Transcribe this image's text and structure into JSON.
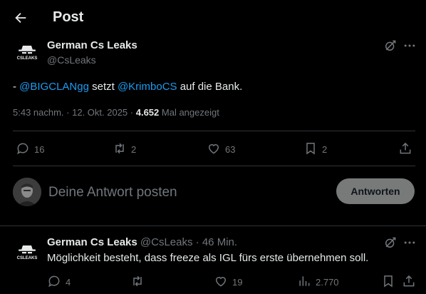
{
  "header": {
    "title": "Post"
  },
  "post": {
    "author_name": "German Cs Leaks",
    "author_handle": "@CsLeaks",
    "avatar_text": "CSLEAKS",
    "text_prefix": "- ",
    "mention_1": "@BIGCLANgg",
    "text_mid": " setzt ",
    "mention_2": "@KrimboCS",
    "text_suffix": " auf die Bank.",
    "time": "5:43 nachm.",
    "sep1": " · ",
    "date": "12. Okt. 2025",
    "sep2": " · ",
    "views_count": "4.652",
    "views_label": " Mal angezeigt",
    "replies": "16",
    "reposts": "2",
    "likes": "63",
    "bookmarks": "2"
  },
  "composer": {
    "placeholder": "Deine Antwort posten",
    "button_label": "Antworten"
  },
  "reply": {
    "author_name": "German Cs Leaks",
    "author_handle": "@CsLeaks",
    "separator": " · ",
    "time": "46 Min.",
    "avatar_text": "CSLEAKS",
    "text": "Möglichkeit besteht, dass freeze als IGL fürs erste übernehmen soll.",
    "replies": "4",
    "reposts": "",
    "likes": "19",
    "views": "2.770"
  },
  "colors": {
    "accent": "#1d9bf0",
    "muted": "#71767b",
    "divider": "#2f3336",
    "background": "#000000"
  },
  "icons": [
    "back-arrow-icon",
    "grok-icon",
    "more-icon",
    "reply-icon",
    "repost-icon",
    "like-icon",
    "bookmark-icon",
    "share-icon",
    "views-icon"
  ]
}
